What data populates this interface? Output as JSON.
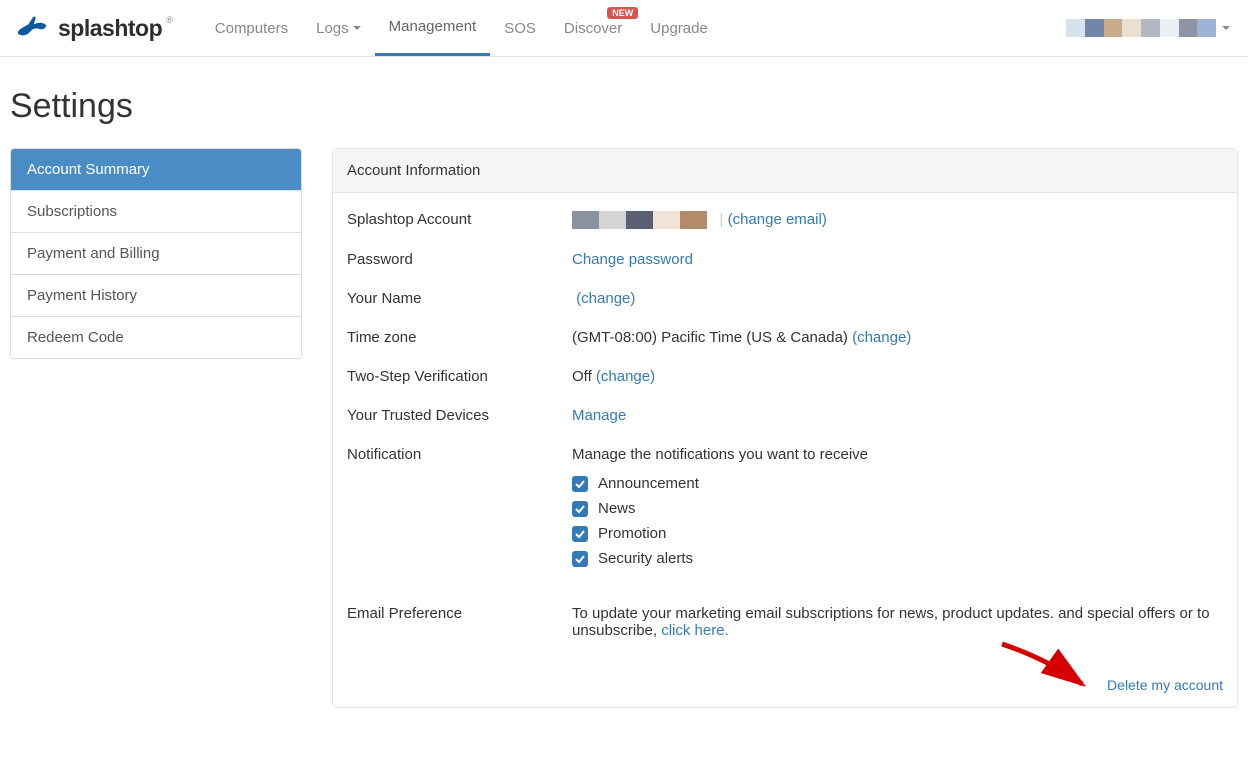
{
  "nav": {
    "logo_text": "splashtop",
    "items": [
      {
        "label": "Computers",
        "active": false,
        "dropdown": false
      },
      {
        "label": "Logs",
        "active": false,
        "dropdown": true
      },
      {
        "label": "Management",
        "active": true,
        "dropdown": false
      },
      {
        "label": "SOS",
        "active": false,
        "dropdown": false
      },
      {
        "label": "Discover",
        "active": false,
        "dropdown": false,
        "badge": "NEW"
      },
      {
        "label": "Upgrade",
        "active": false,
        "dropdown": false
      }
    ]
  },
  "page_title": "Settings",
  "sidebar": {
    "items": [
      {
        "label": "Account Summary",
        "active": true
      },
      {
        "label": "Subscriptions",
        "active": false
      },
      {
        "label": "Payment and Billing",
        "active": false
      },
      {
        "label": "Payment History",
        "active": false
      },
      {
        "label": "Redeem Code",
        "active": false
      }
    ]
  },
  "panel": {
    "header": "Account Information",
    "account_label": "Splashtop Account",
    "change_email_link": "(change email)",
    "password_label": "Password",
    "change_password_link": "Change password",
    "name_label": "Your Name",
    "change_name_link": "(change)",
    "tz_label": "Time zone",
    "tz_value": "(GMT-08:00) Pacific Time (US & Canada)",
    "tz_change": "(change)",
    "twostep_label": "Two-Step Verification",
    "twostep_value": "Off",
    "twostep_change": "(change)",
    "trusted_label": "Your Trusted Devices",
    "trusted_link": "Manage",
    "notif_label": "Notification",
    "notif_desc": "Manage the notifications you want to receive",
    "notif_options": [
      "Announcement",
      "News",
      "Promotion",
      "Security alerts"
    ],
    "emailpref_label": "Email Preference",
    "emailpref_text": "To update your marketing email subscriptions for news, product updates. and special offers or to unsubscribe, ",
    "emailpref_link": "click here.",
    "delete_link": "Delete my account"
  }
}
